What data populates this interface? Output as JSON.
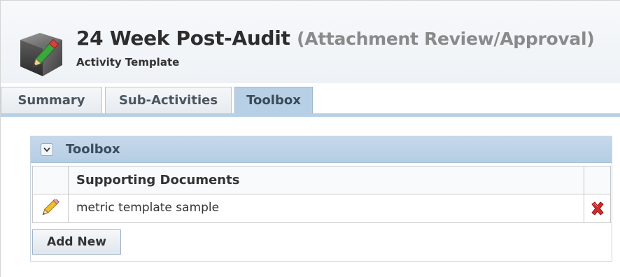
{
  "header": {
    "title": "24 Week Post-Audit",
    "title_paren": "(Attachment Review/Approval)",
    "subtitle": "Activity Template",
    "icon": "activity-template-edit-icon"
  },
  "tabs": [
    {
      "label": "Summary",
      "active": false
    },
    {
      "label": "Sub-Activities",
      "active": false
    },
    {
      "label": "Toolbox",
      "active": true
    }
  ],
  "panel": {
    "title": "Toolbox",
    "collapse_icon": "chevron-down-icon",
    "table": {
      "columns": [
        "Supporting Documents"
      ],
      "rows": [
        {
          "name": "metric template sample",
          "edit_icon": "pencil-icon",
          "delete_icon": "delete-x-icon"
        }
      ]
    },
    "add_button_label": "Add New"
  },
  "colors": {
    "tab_active": "#b8d0e6",
    "panel_header": "#b5cde3",
    "delete": "#d02020",
    "pencil": "#e8b020"
  }
}
